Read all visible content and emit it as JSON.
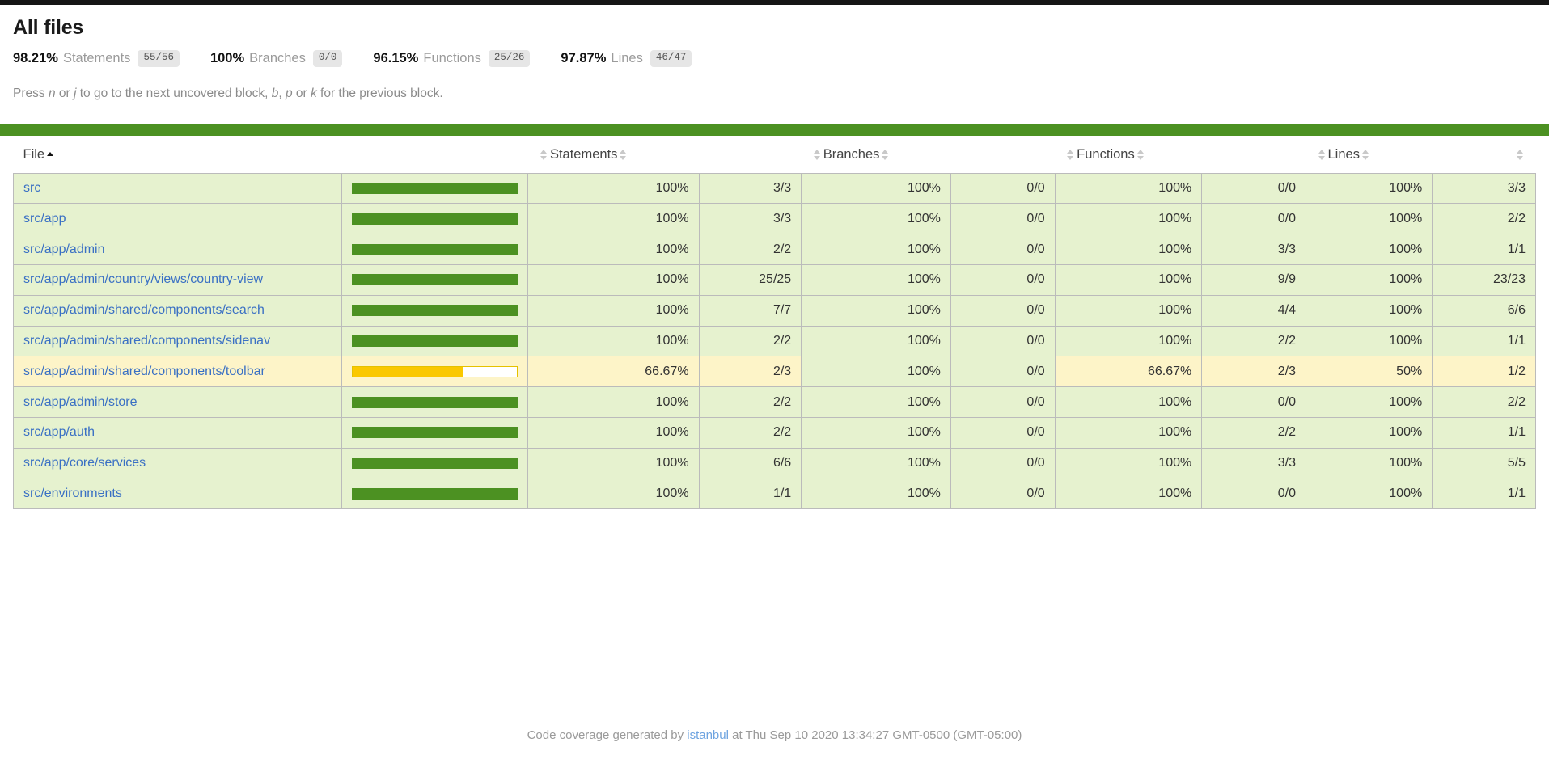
{
  "page": {
    "title": "All files",
    "hint_prefix": "Press ",
    "hint_key_1": "n",
    "hint_mid_1": " or ",
    "hint_key_2": "j",
    "hint_mid_2": " to go to the next uncovered block, ",
    "hint_key_3": "b",
    "hint_mid_3": ", ",
    "hint_key_4": "p",
    "hint_mid_4": " or ",
    "hint_key_5": "k",
    "hint_suffix": " for the previous block."
  },
  "colors": {
    "high": "#4c9122",
    "high_bg": "#e6f2cf",
    "medium": "#fac800",
    "medium_bg": "#fdf4c8",
    "link": "#3a70c4",
    "status_bar": "#4c9122"
  },
  "summary": [
    {
      "pct": "98.21%",
      "name": "Statements",
      "fraction": "55/56"
    },
    {
      "pct": "100%",
      "name": "Branches",
      "fraction": "0/0"
    },
    {
      "pct": "96.15%",
      "name": "Functions",
      "fraction": "25/26"
    },
    {
      "pct": "97.87%",
      "name": "Lines",
      "fraction": "46/47"
    }
  ],
  "table": {
    "headers": {
      "file": "File",
      "statements": "Statements",
      "branches": "Branches",
      "functions": "Functions",
      "lines": "Lines"
    },
    "sort": {
      "column": "File",
      "direction": "asc"
    },
    "rows": [
      {
        "file": "src",
        "level": "high",
        "bar_pct": 100,
        "statements_pct": "100%",
        "statements_abs": "3/3",
        "statements_level": "high",
        "branches_pct": "100%",
        "branches_abs": "0/0",
        "branches_level": "high",
        "functions_pct": "100%",
        "functions_abs": "0/0",
        "functions_level": "high",
        "lines_pct": "100%",
        "lines_abs": "3/3",
        "lines_level": "high"
      },
      {
        "file": "src/app",
        "level": "high",
        "bar_pct": 100,
        "statements_pct": "100%",
        "statements_abs": "3/3",
        "statements_level": "high",
        "branches_pct": "100%",
        "branches_abs": "0/0",
        "branches_level": "high",
        "functions_pct": "100%",
        "functions_abs": "0/0",
        "functions_level": "high",
        "lines_pct": "100%",
        "lines_abs": "2/2",
        "lines_level": "high"
      },
      {
        "file": "src/app/admin",
        "level": "high",
        "bar_pct": 100,
        "statements_pct": "100%",
        "statements_abs": "2/2",
        "statements_level": "high",
        "branches_pct": "100%",
        "branches_abs": "0/0",
        "branches_level": "high",
        "functions_pct": "100%",
        "functions_abs": "3/3",
        "functions_level": "high",
        "lines_pct": "100%",
        "lines_abs": "1/1",
        "lines_level": "high"
      },
      {
        "file": "src/app/admin/country/views/country-view",
        "level": "high",
        "bar_pct": 100,
        "statements_pct": "100%",
        "statements_abs": "25/25",
        "statements_level": "high",
        "branches_pct": "100%",
        "branches_abs": "0/0",
        "branches_level": "high",
        "functions_pct": "100%",
        "functions_abs": "9/9",
        "functions_level": "high",
        "lines_pct": "100%",
        "lines_abs": "23/23",
        "lines_level": "high"
      },
      {
        "file": "src/app/admin/shared/components/search",
        "level": "high",
        "bar_pct": 100,
        "statements_pct": "100%",
        "statements_abs": "7/7",
        "statements_level": "high",
        "branches_pct": "100%",
        "branches_abs": "0/0",
        "branches_level": "high",
        "functions_pct": "100%",
        "functions_abs": "4/4",
        "functions_level": "high",
        "lines_pct": "100%",
        "lines_abs": "6/6",
        "lines_level": "high"
      },
      {
        "file": "src/app/admin/shared/components/sidenav",
        "level": "high",
        "bar_pct": 100,
        "statements_pct": "100%",
        "statements_abs": "2/2",
        "statements_level": "high",
        "branches_pct": "100%",
        "branches_abs": "0/0",
        "branches_level": "high",
        "functions_pct": "100%",
        "functions_abs": "2/2",
        "functions_level": "high",
        "lines_pct": "100%",
        "lines_abs": "1/1",
        "lines_level": "high"
      },
      {
        "file": "src/app/admin/shared/components/toolbar",
        "level": "medium",
        "bar_pct": 66.67,
        "statements_pct": "66.67%",
        "statements_abs": "2/3",
        "statements_level": "medium",
        "branches_pct": "100%",
        "branches_abs": "0/0",
        "branches_level": "high",
        "functions_pct": "66.67%",
        "functions_abs": "2/3",
        "functions_level": "medium",
        "lines_pct": "50%",
        "lines_abs": "1/2",
        "lines_level": "medium"
      },
      {
        "file": "src/app/admin/store",
        "level": "high",
        "bar_pct": 100,
        "statements_pct": "100%",
        "statements_abs": "2/2",
        "statements_level": "high",
        "branches_pct": "100%",
        "branches_abs": "0/0",
        "branches_level": "high",
        "functions_pct": "100%",
        "functions_abs": "0/0",
        "functions_level": "high",
        "lines_pct": "100%",
        "lines_abs": "2/2",
        "lines_level": "high"
      },
      {
        "file": "src/app/auth",
        "level": "high",
        "bar_pct": 100,
        "statements_pct": "100%",
        "statements_abs": "2/2",
        "statements_level": "high",
        "branches_pct": "100%",
        "branches_abs": "0/0",
        "branches_level": "high",
        "functions_pct": "100%",
        "functions_abs": "2/2",
        "functions_level": "high",
        "lines_pct": "100%",
        "lines_abs": "1/1",
        "lines_level": "high"
      },
      {
        "file": "src/app/core/services",
        "level": "high",
        "bar_pct": 100,
        "statements_pct": "100%",
        "statements_abs": "6/6",
        "statements_level": "high",
        "branches_pct": "100%",
        "branches_abs": "0/0",
        "branches_level": "high",
        "functions_pct": "100%",
        "functions_abs": "3/3",
        "functions_level": "high",
        "lines_pct": "100%",
        "lines_abs": "5/5",
        "lines_level": "high"
      },
      {
        "file": "src/environments",
        "level": "high",
        "bar_pct": 100,
        "statements_pct": "100%",
        "statements_abs": "1/1",
        "statements_level": "high",
        "branches_pct": "100%",
        "branches_abs": "0/0",
        "branches_level": "high",
        "functions_pct": "100%",
        "functions_abs": "0/0",
        "functions_level": "high",
        "lines_pct": "100%",
        "lines_abs": "1/1",
        "lines_level": "high"
      }
    ]
  },
  "footer": {
    "prefix": "Code coverage generated by ",
    "tool": "istanbul",
    "suffix": " at Thu Sep 10 2020 13:34:27 GMT-0500 (GMT-05:00)"
  }
}
